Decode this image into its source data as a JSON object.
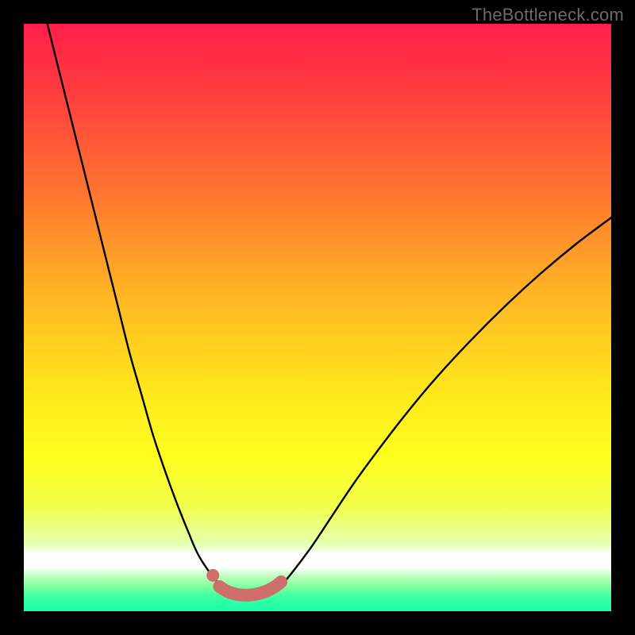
{
  "watermark": "TheBottleneck.com",
  "gradient_stops": [
    {
      "offset": 0.0,
      "color": "#ff1f4a"
    },
    {
      "offset": 0.12,
      "color": "#ff3e3e"
    },
    {
      "offset": 0.3,
      "color": "#ff7a2f"
    },
    {
      "offset": 0.46,
      "color": "#ffb524"
    },
    {
      "offset": 0.62,
      "color": "#ffe61c"
    },
    {
      "offset": 0.74,
      "color": "#ffff20"
    },
    {
      "offset": 0.82,
      "color": "#f2ff4a"
    },
    {
      "offset": 0.885,
      "color": "#e6ffb0"
    },
    {
      "offset": 0.905,
      "color": "#ffffff"
    },
    {
      "offset": 0.925,
      "color": "#ffffff"
    },
    {
      "offset": 0.94,
      "color": "#c1ffc1"
    },
    {
      "offset": 0.955,
      "color": "#8affa0"
    },
    {
      "offset": 0.975,
      "color": "#3dffa4"
    },
    {
      "offset": 1.0,
      "color": "#18ffa8"
    }
  ],
  "chart_data": {
    "type": "line",
    "title": "",
    "xlabel": "",
    "ylabel": "",
    "xlim": [
      0,
      100
    ],
    "ylim": [
      0,
      100
    ],
    "series": [
      {
        "name": "left-branch",
        "x": [
          4,
          6,
          8,
          10,
          12,
          14,
          16,
          18,
          20,
          22,
          24,
          26,
          28,
          29.5,
          31,
          32.5,
          33.5,
          34.5
        ],
        "y": [
          100,
          92,
          84,
          76,
          68,
          60,
          52,
          44,
          37,
          30,
          24,
          18.5,
          13.5,
          10,
          7.5,
          5.5,
          4.3,
          3.6
        ]
      },
      {
        "name": "right-branch",
        "x": [
          42.5,
          44,
          46,
          49,
          52,
          56,
          60,
          65,
          70,
          76,
          82,
          88,
          94,
          100
        ],
        "y": [
          3.6,
          4.6,
          7,
          11,
          15.5,
          21.5,
          27,
          33.5,
          39.5,
          46,
          52,
          57.5,
          62.5,
          67
        ]
      },
      {
        "name": "valley-highlight",
        "x": [
          33.3,
          34.2,
          35.2,
          36.3,
          37.5,
          38.7,
          39.9,
          41.0,
          42.0,
          43.0,
          43.8
        ],
        "y": [
          4.2,
          3.6,
          3.15,
          2.85,
          2.73,
          2.77,
          2.98,
          3.3,
          3.75,
          4.35,
          5.0
        ]
      }
    ],
    "markers": [
      {
        "name": "valley-dot",
        "x": 32.2,
        "y": 6.1
      }
    ],
    "colors": {
      "curve": "#000000",
      "highlight": "#cf6f6c"
    }
  }
}
